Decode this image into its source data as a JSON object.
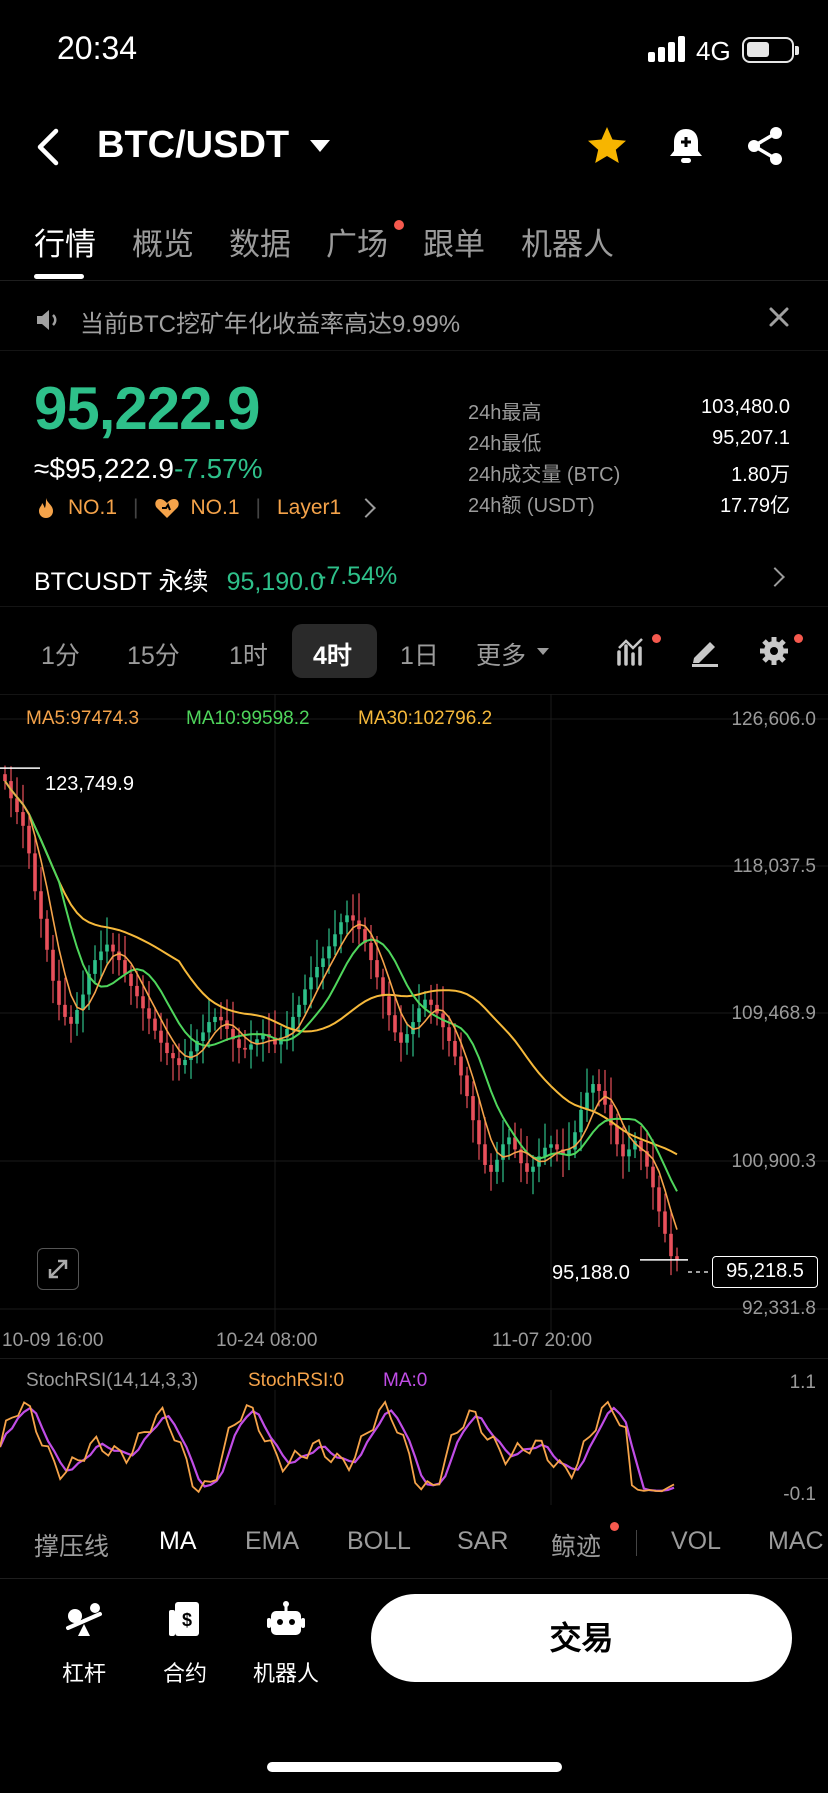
{
  "status_bar": {
    "time": "20:34",
    "network": "4G"
  },
  "header": {
    "pair": "BTC/USDT"
  },
  "tabs": [
    {
      "label": "行情",
      "active": true
    },
    {
      "label": "概览"
    },
    {
      "label": "数据"
    },
    {
      "label": "广场",
      "dot": true
    },
    {
      "label": "跟单"
    },
    {
      "label": "机器人"
    }
  ],
  "notice": {
    "text": "当前BTC挖矿年化收益率高达9.99%"
  },
  "price": {
    "last": "95,222.9",
    "fiat": "≈$95,222.9",
    "change": "-7.57%",
    "rank1": "NO.1",
    "rank2": "NO.1",
    "tag": "Layer1"
  },
  "stats": [
    {
      "label": "24h最高",
      "value": "103,480.0"
    },
    {
      "label": "24h最低",
      "value": "95,207.1"
    },
    {
      "label": "24h成交量 (BTC)",
      "value": "1.80万"
    },
    {
      "label": "24h额 (USDT)",
      "value": "17.79亿"
    }
  ],
  "perp": {
    "name": "BTCUSDT 永续",
    "price": "95,190.0",
    "change": "-7.54%"
  },
  "timeframes": [
    "1分",
    "15分",
    "1时",
    "4时",
    "1日",
    "更多"
  ],
  "active_timeframe": "4时",
  "ma_legend": {
    "ma5": "MA5:97474.3",
    "ma10": "MA10:99598.2",
    "ma30": "MA30:102796.2"
  },
  "price_axis": [
    "126,606.0",
    "118,037.5",
    "109,468.9",
    "100,900.3",
    "92,331.8"
  ],
  "high_marker": "123,749.9",
  "low_marker": "95,188.0",
  "current_price": "95,218.5",
  "time_axis": [
    "10-09 16:00",
    "10-24 08:00",
    "11-07 20:00"
  ],
  "stoch": {
    "title": "StochRSI(14,14,3,3)",
    "k": "StochRSI:0",
    "ma": "MA:0",
    "top": "1.1",
    "bottom": "-0.1"
  },
  "indicators": [
    "撑压线",
    "MA",
    "EMA",
    "BOLL",
    "SAR",
    "鲸迹",
    "VOL",
    "MAC"
  ],
  "bottom_nav": [
    {
      "label": "杠杆",
      "icon": "leverage-icon"
    },
    {
      "label": "合约",
      "icon": "contract-icon"
    },
    {
      "label": "机器人",
      "icon": "robot-icon"
    }
  ],
  "trade_button": "交易",
  "colors": {
    "up": "#2ec08a",
    "down": "#e8505b",
    "ma5": "#f5a34a",
    "ma10": "#4fd65c",
    "ma30": "#f6b93b",
    "stoch_k": "#f5a34a",
    "stoch_ma": "#c04de6"
  },
  "chart_data": {
    "type": "candlestick",
    "interval": "4时",
    "ylim": [
      92331.8,
      126606.0
    ],
    "closes": [
      123000,
      122000,
      121200,
      120400,
      118800,
      116600,
      115000,
      113200,
      111400,
      110000,
      109300,
      108900,
      109700,
      110600,
      111800,
      112600,
      113100,
      113500,
      113100,
      112600,
      111800,
      111100,
      110500,
      109800,
      109200,
      108500,
      107800,
      107200,
      106900,
      106500,
      106800,
      107300,
      107900,
      108400,
      109000,
      109300,
      109100,
      108600,
      108000,
      107500,
      107400,
      107700,
      108000,
      108300,
      108100,
      107700,
      108100,
      108600,
      109300,
      110000,
      110900,
      111600,
      112200,
      112700,
      113400,
      114100,
      114800,
      115200,
      114900,
      114400,
      113600,
      112600,
      111600,
      110500,
      109400,
      108400,
      107800,
      108300,
      109000,
      109800,
      110300,
      110000,
      109500,
      108700,
      107900,
      107000,
      105900,
      104700,
      103300,
      101900,
      100700,
      100300,
      101000,
      101900,
      102300,
      101600,
      100800,
      100300,
      100600,
      101200,
      101700,
      101900,
      101600,
      101300,
      101600,
      102600,
      103900,
      104900,
      105400,
      105000,
      104200,
      103000,
      101900,
      101200,
      101600,
      102100,
      101500,
      100600,
      99400,
      98000,
      96700,
      95400,
      95220
    ]
  }
}
